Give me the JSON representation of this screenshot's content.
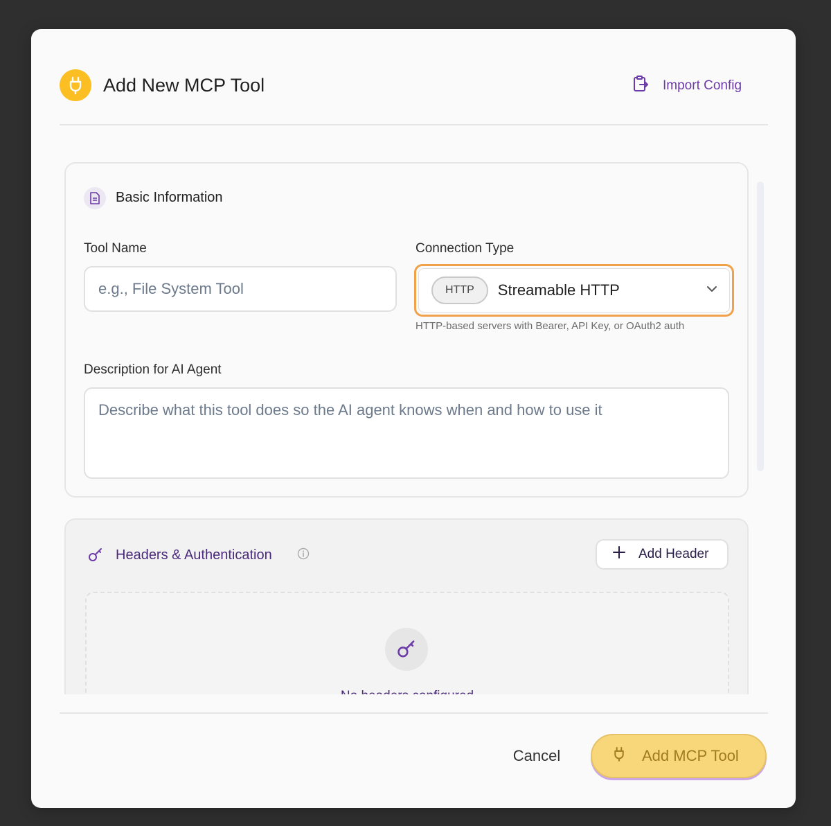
{
  "dialog": {
    "title": "Add New MCP Tool",
    "import_label": "Import Config"
  },
  "basic_info": {
    "title": "Basic Information",
    "tool_name_label": "Tool Name",
    "tool_name_placeholder": "e.g., File System Tool",
    "connection_type_label": "Connection Type",
    "connection_badge": "HTTP",
    "connection_value": "Streamable HTTP",
    "connection_hint": "HTTP-based servers with Bearer, API Key, or OAuth2 auth",
    "description_label": "Description for AI Agent",
    "description_placeholder": "Describe what this tool does so the AI agent knows when and how to use it"
  },
  "headers": {
    "title": "Headers & Authentication",
    "add_label": "Add Header",
    "empty_text": "No headers configured"
  },
  "footer": {
    "cancel_label": "Cancel",
    "submit_label": "Add MCP Tool"
  },
  "colors": {
    "accent_yellow": "#fbbf24",
    "accent_purple": "#6b3aa8",
    "focus_orange": "#f0a14a"
  },
  "icons": [
    "plug-icon",
    "clipboard-import-icon",
    "document-icon",
    "chevron-down-icon",
    "key-icon",
    "info-icon",
    "plus-icon"
  ]
}
